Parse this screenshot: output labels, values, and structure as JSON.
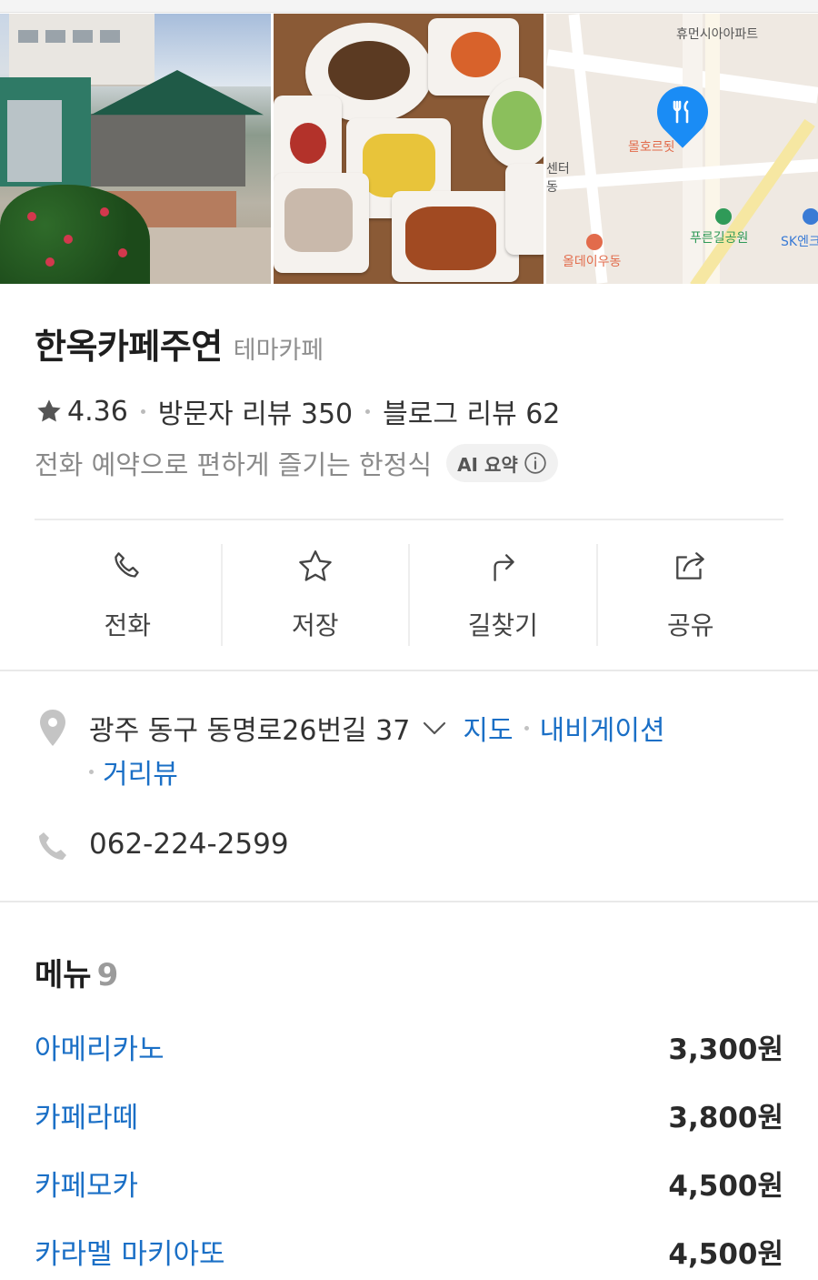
{
  "place": {
    "name": "한옥카페주연",
    "category": "테마카페",
    "rating": "4.36",
    "visitor_reviews": "방문자 리뷰 350",
    "blog_reviews": "블로그 리뷰 62",
    "summary": "전화 예약으로 편하게 즐기는 한정식",
    "ai_badge": "AI 요약"
  },
  "photos": {
    "map_labels": [
      "휴먼시아아파트",
      "몰호르됫",
      "센터",
      "동",
      "푸른길공원",
      "SK엔크",
      "올데이우동"
    ]
  },
  "actions": [
    {
      "label": "전화",
      "icon": "phone-icon"
    },
    {
      "label": "저장",
      "icon": "star-outline-icon"
    },
    {
      "label": "길찾기",
      "icon": "directions-icon"
    },
    {
      "label": "공유",
      "icon": "share-icon"
    }
  ],
  "address": {
    "text": "광주 동구 동명로26번길 37",
    "links": {
      "map": "지도",
      "navigation": "내비게이션",
      "street_view": "거리뷰"
    }
  },
  "phone": "062-224-2599",
  "menu": {
    "title": "메뉴",
    "count": "9",
    "items": [
      {
        "name": "아메리카노",
        "price": "3,300원"
      },
      {
        "name": "카페라떼",
        "price": "3,800원"
      },
      {
        "name": "카페모카",
        "price": "4,500원"
      },
      {
        "name": "카라멜 마키아또",
        "price": "4,500원"
      }
    ]
  },
  "colors": {
    "link": "#1a6fc6",
    "map_pin": "#1a8cf5",
    "text_dark": "#1e1e1e",
    "text_muted": "#8a8a8a"
  }
}
